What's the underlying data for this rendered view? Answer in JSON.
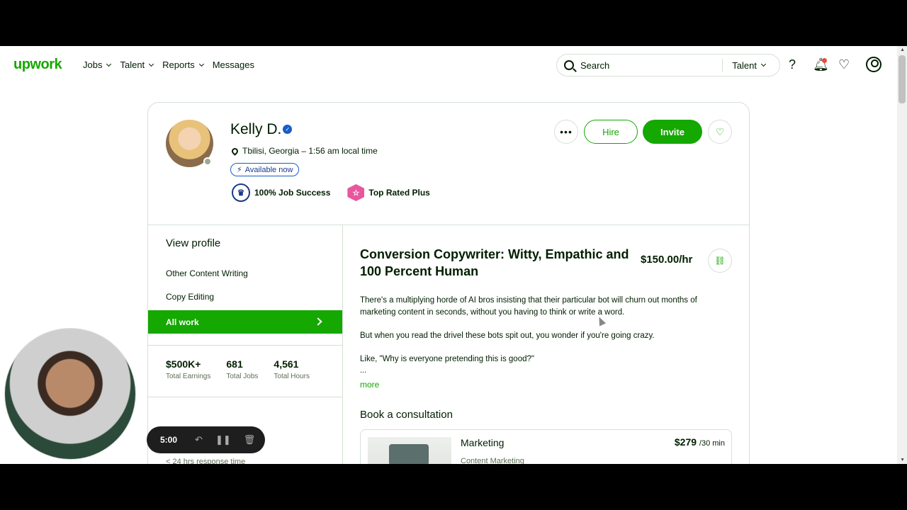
{
  "nav": {
    "logo": "upwork",
    "links": [
      "Jobs",
      "Talent",
      "Reports",
      "Messages"
    ],
    "search_placeholder": "Search",
    "search_scope": "Talent"
  },
  "profile": {
    "name": "Kelly D.",
    "location": "Tbilisi, Georgia – 1:56 am local time",
    "availability": "Available now",
    "job_success": "100% Job Success",
    "badge": "Top Rated Plus",
    "hire": "Hire",
    "invite": "Invite"
  },
  "sidebar": {
    "view_profile": "View profile",
    "specializations": [
      "Other Content Writing",
      "Copy Editing"
    ],
    "all_work": "All work",
    "stats": [
      {
        "value": "$500K+",
        "label": "Total Earnings"
      },
      {
        "value": "681",
        "label": "Total Jobs"
      },
      {
        "value": "4,561",
        "label": "Total Hours"
      }
    ],
    "response": "< 24 hrs response time"
  },
  "main": {
    "title": "Conversion Copywriter: Witty, Empathic and 100 Percent Human",
    "rate": "$150.00/hr",
    "bio": [
      "There's a multiplying horde of AI bros insisting that their particular bot will churn out months of marketing content in seconds, without you having to think or write a word.",
      "But when you read the drivel these bots spit out, you wonder if you're going crazy.",
      "Like, \"Why is everyone pretending this is good?\""
    ],
    "ellipsis": "...",
    "more": "more",
    "consultation_heading": "Book a consultation",
    "consultation": {
      "title": "Marketing",
      "subtitle": "Content Marketing",
      "price": "$279",
      "unit": "/30 min"
    }
  },
  "recorder": {
    "time": "5:00"
  },
  "colors": {
    "brand": "#14a800",
    "text": "#001e00",
    "border": "#d5e0d5"
  }
}
